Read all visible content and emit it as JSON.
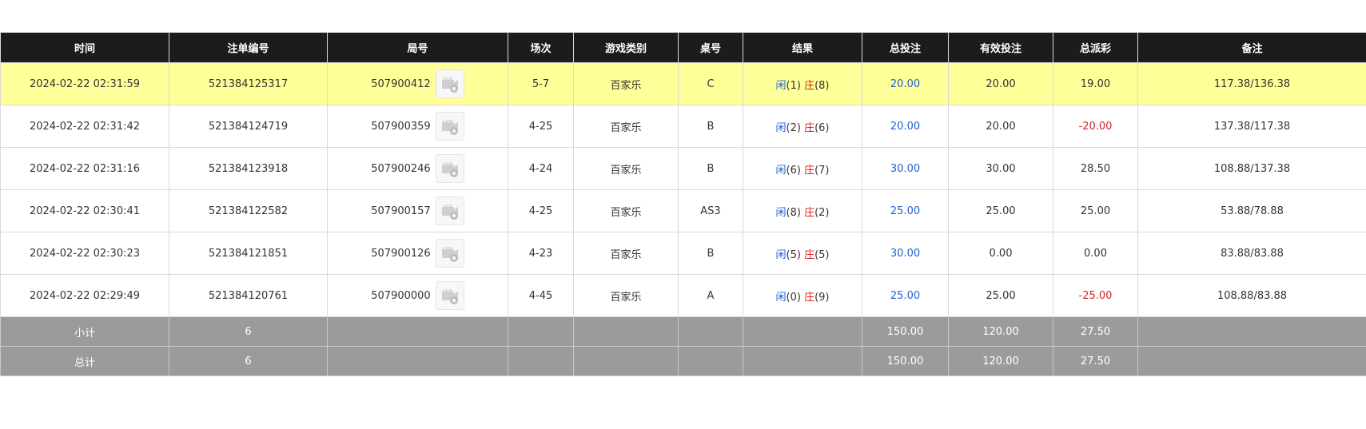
{
  "headers": [
    "时间",
    "注单编号",
    "局号",
    "场次",
    "游戏类别",
    "桌号",
    "结果",
    "总投注",
    "有效投注",
    "总派彩",
    "备注"
  ],
  "rows": [
    {
      "time": "2024-02-22 02:31:59",
      "bet_id": "521384125317",
      "round_no": "507900412",
      "session": "5-7",
      "game_type": "百家乐",
      "table": "C",
      "player_label": "闲",
      "player_score": "(1)",
      "banker_label": "庄",
      "banker_score": "(8)",
      "total_bet": "20.00",
      "valid_bet": "20.00",
      "payout": "19.00",
      "payout_color": "#333333",
      "remark": "117.38/136.38",
      "highlight": true
    },
    {
      "time": "2024-02-22 02:31:42",
      "bet_id": "521384124719",
      "round_no": "507900359",
      "session": "4-25",
      "game_type": "百家乐",
      "table": "B",
      "player_label": "闲",
      "player_score": "(2)",
      "banker_label": "庄",
      "banker_score": "(6)",
      "total_bet": "20.00",
      "valid_bet": "20.00",
      "payout": "-20.00",
      "payout_color": "#d42424",
      "remark": "137.38/117.38",
      "highlight": false
    },
    {
      "time": "2024-02-22 02:31:16",
      "bet_id": "521384123918",
      "round_no": "507900246",
      "session": "4-24",
      "game_type": "百家乐",
      "table": "B",
      "player_label": "闲",
      "player_score": "(6)",
      "banker_label": "庄",
      "banker_score": "(7)",
      "total_bet": "30.00",
      "valid_bet": "30.00",
      "payout": "28.50",
      "payout_color": "#333333",
      "remark": "108.88/137.38",
      "highlight": false
    },
    {
      "time": "2024-02-22 02:30:41",
      "bet_id": "521384122582",
      "round_no": "507900157",
      "session": "4-25",
      "game_type": "百家乐",
      "table": "AS3",
      "player_label": "闲",
      "player_score": "(8)",
      "banker_label": "庄",
      "banker_score": "(2)",
      "total_bet": "25.00",
      "valid_bet": "25.00",
      "payout": "25.00",
      "payout_color": "#333333",
      "remark": "53.88/78.88",
      "highlight": false
    },
    {
      "time": "2024-02-22 02:30:23",
      "bet_id": "521384121851",
      "round_no": "507900126",
      "session": "4-23",
      "game_type": "百家乐",
      "table": "B",
      "player_label": "闲",
      "player_score": "(5)",
      "banker_label": "庄",
      "banker_score": "(5)",
      "total_bet": "30.00",
      "valid_bet": "0.00",
      "payout": "0.00",
      "payout_color": "#333333",
      "remark": "83.88/83.88",
      "highlight": false
    },
    {
      "time": "2024-02-22 02:29:49",
      "bet_id": "521384120761",
      "round_no": "507900000",
      "session": "4-45",
      "game_type": "百家乐",
      "table": "A",
      "player_label": "闲",
      "player_score": "(0)",
      "banker_label": "庄",
      "banker_score": "(9)",
      "total_bet": "25.00",
      "valid_bet": "25.00",
      "payout": "-25.00",
      "payout_color": "#d42424",
      "remark": "108.88/83.88",
      "highlight": false
    }
  ],
  "subtotal": {
    "label": "小计",
    "count": "6",
    "total_bet": "150.00",
    "valid_bet": "120.00",
    "payout": "27.50"
  },
  "grandtotal": {
    "label": "总计",
    "count": "6",
    "total_bet": "150.00",
    "valid_bet": "120.00",
    "payout": "27.50"
  },
  "icons": {
    "replay": "video-replay-icon"
  },
  "colors": {
    "header_bg": "#1c1c1c",
    "highlight_bg": "#ffff99",
    "summary_bg": "#9b9b9b",
    "bet_blue": "#1f5fd6",
    "loss_red": "#d42424"
  }
}
